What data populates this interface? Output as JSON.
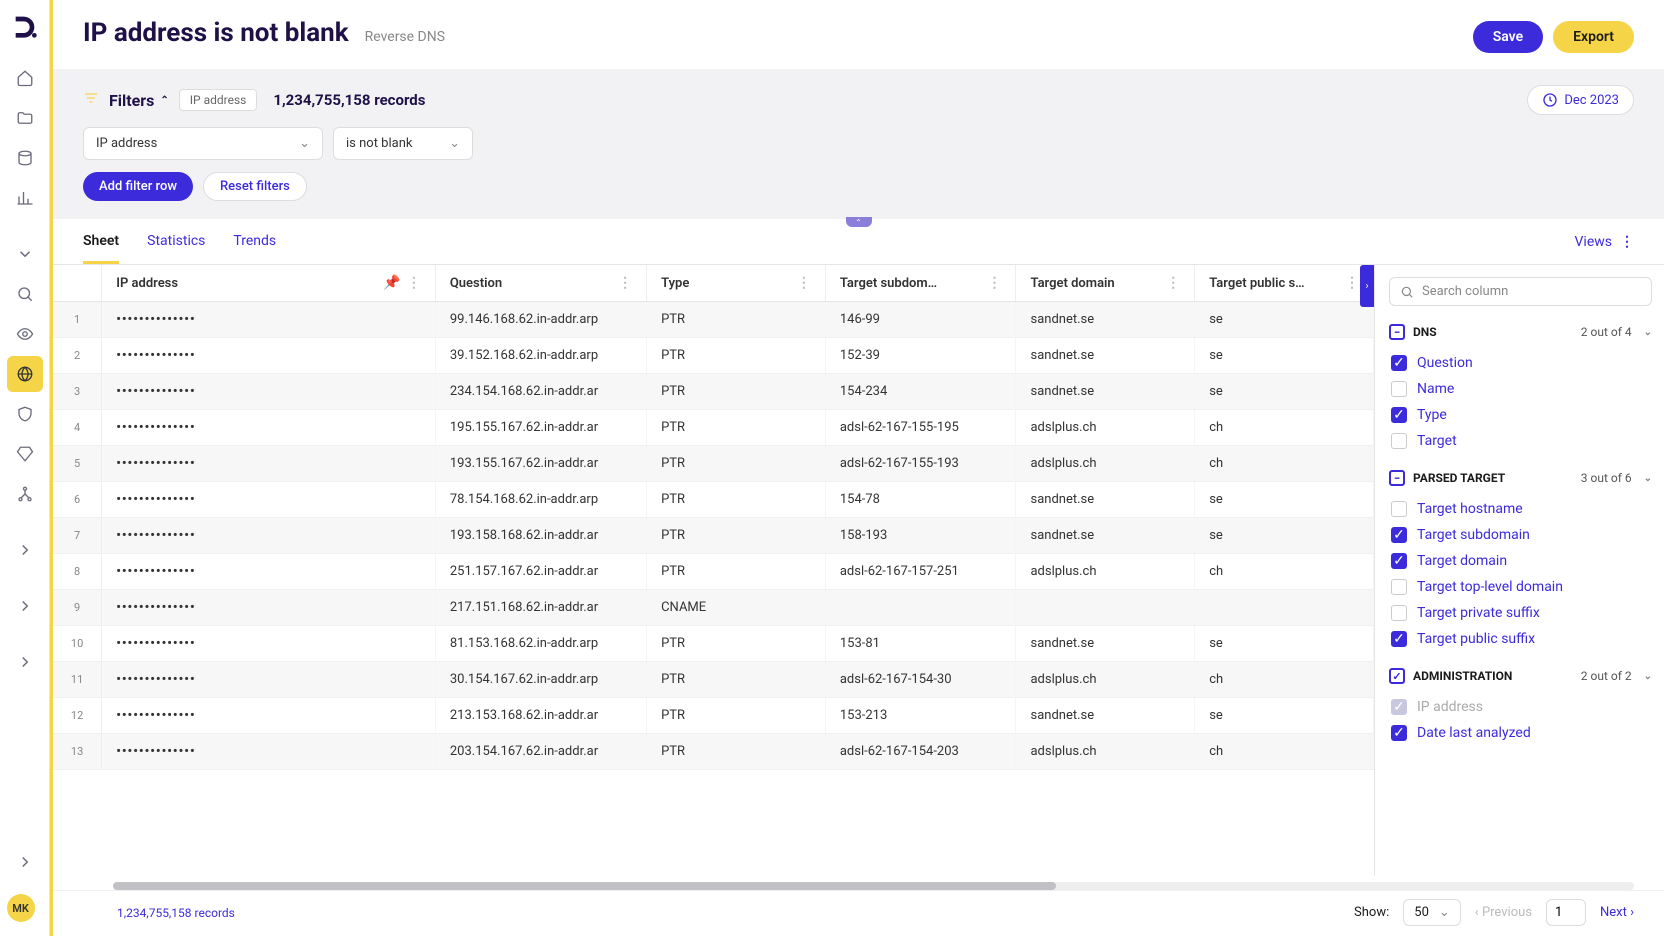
{
  "header": {
    "title": "IP address is not blank",
    "subtitle": "Reverse DNS",
    "save": "Save",
    "export": "Export"
  },
  "filters": {
    "label": "Filters",
    "chip": "IP address",
    "record_count": "1,234,755,158 records",
    "date": "Dec 2023",
    "field": "IP address",
    "op": "is not blank",
    "add_row": "Add filter row",
    "reset": "Reset filters"
  },
  "tabs": {
    "sheet": "Sheet",
    "statistics": "Statistics",
    "trends": "Trends",
    "views": "Views"
  },
  "columns": {
    "ip": "IP address",
    "question": "Question",
    "type": "Type",
    "target_subdom": "Target subdom…",
    "target_domain": "Target domain",
    "target_public_s": "Target public s…"
  },
  "rows": [
    {
      "n": "1",
      "ip": "••••••••••••••",
      "q": "99.146.168.62.in-addr.arp",
      "t": "PTR",
      "sub": "146-99",
      "dom": "sandnet.se",
      "suf": "se"
    },
    {
      "n": "2",
      "ip": "••••••••••••••",
      "q": "39.152.168.62.in-addr.arp",
      "t": "PTR",
      "sub": "152-39",
      "dom": "sandnet.se",
      "suf": "se"
    },
    {
      "n": "3",
      "ip": "••••••••••••••",
      "q": "234.154.168.62.in-addr.ar",
      "t": "PTR",
      "sub": "154-234",
      "dom": "sandnet.se",
      "suf": "se"
    },
    {
      "n": "4",
      "ip": "••••••••••••••",
      "q": "195.155.167.62.in-addr.ar",
      "t": "PTR",
      "sub": "adsl-62-167-155-195",
      "dom": "adslplus.ch",
      "suf": "ch"
    },
    {
      "n": "5",
      "ip": "••••••••••••••",
      "q": "193.155.167.62.in-addr.ar",
      "t": "PTR",
      "sub": "adsl-62-167-155-193",
      "dom": "adslplus.ch",
      "suf": "ch"
    },
    {
      "n": "6",
      "ip": "••••••••••••••",
      "q": "78.154.168.62.in-addr.arp",
      "t": "PTR",
      "sub": "154-78",
      "dom": "sandnet.se",
      "suf": "se"
    },
    {
      "n": "7",
      "ip": "••••••••••••••",
      "q": "193.158.168.62.in-addr.ar",
      "t": "PTR",
      "sub": "158-193",
      "dom": "sandnet.se",
      "suf": "se"
    },
    {
      "n": "8",
      "ip": "••••••••••••••",
      "q": "251.157.167.62.in-addr.ar",
      "t": "PTR",
      "sub": "adsl-62-167-157-251",
      "dom": "adslplus.ch",
      "suf": "ch"
    },
    {
      "n": "9",
      "ip": "••••••••••••••",
      "q": "217.151.168.62.in-addr.ar",
      "t": "CNAME",
      "sub": "",
      "dom": "",
      "suf": ""
    },
    {
      "n": "10",
      "ip": "••••••••••••••",
      "q": "81.153.168.62.in-addr.arp",
      "t": "PTR",
      "sub": "153-81",
      "dom": "sandnet.se",
      "suf": "se"
    },
    {
      "n": "11",
      "ip": "••••••••••••••",
      "q": "30.154.167.62.in-addr.arp",
      "t": "PTR",
      "sub": "adsl-62-167-154-30",
      "dom": "adslplus.ch",
      "suf": "ch"
    },
    {
      "n": "12",
      "ip": "••••••••••••••",
      "q": "213.153.168.62.in-addr.ar",
      "t": "PTR",
      "sub": "153-213",
      "dom": "sandnet.se",
      "suf": "se"
    },
    {
      "n": "13",
      "ip": "••••••••••••••",
      "q": "203.154.167.62.in-addr.ar",
      "t": "PTR",
      "sub": "adsl-62-167-154-203",
      "dom": "adslplus.ch",
      "suf": "ch"
    }
  ],
  "right_panel": {
    "search_placeholder": "Search column",
    "groups": [
      {
        "name": "DNS",
        "count": "2 out of 4",
        "items": [
          {
            "label": "Question",
            "checked": true
          },
          {
            "label": "Name",
            "checked": false
          },
          {
            "label": "Type",
            "checked": true
          },
          {
            "label": "Target",
            "checked": false
          }
        ]
      },
      {
        "name": "PARSED TARGET",
        "count": "3 out of 6",
        "items": [
          {
            "label": "Target hostname",
            "checked": false
          },
          {
            "label": "Target subdomain",
            "checked": true
          },
          {
            "label": "Target domain",
            "checked": true
          },
          {
            "label": "Target top-level domain",
            "checked": false
          },
          {
            "label": "Target private suffix",
            "checked": false
          },
          {
            "label": "Target public suffix",
            "checked": true
          }
        ]
      },
      {
        "name": "ADMINISTRATION",
        "count": "2 out of 2",
        "check_icon": true,
        "items": [
          {
            "label": "IP address",
            "checked": true,
            "disabled": true
          },
          {
            "label": "Date last analyzed",
            "checked": true
          }
        ]
      }
    ]
  },
  "footer": {
    "records": "1,234,755,158 records",
    "show": "Show:",
    "page_size": "50",
    "previous": "Previous",
    "page": "1",
    "next": "Next"
  },
  "avatar": "MK"
}
